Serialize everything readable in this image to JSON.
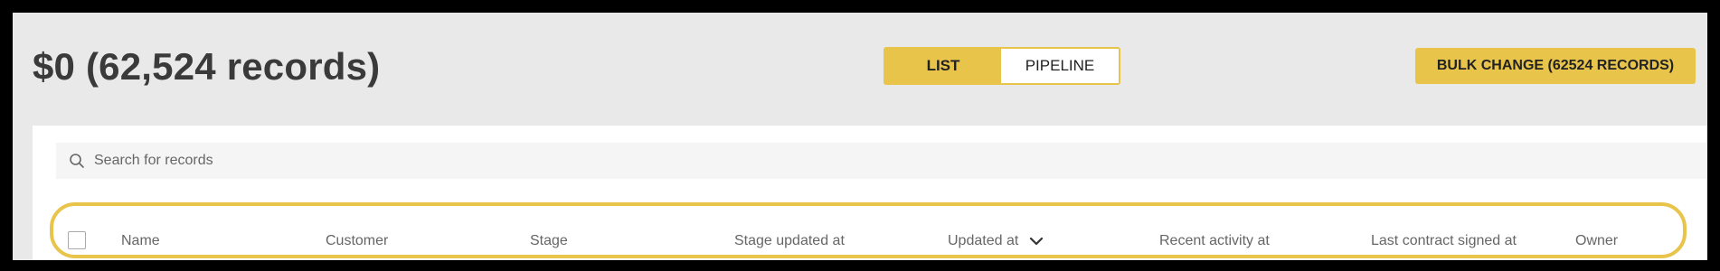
{
  "header": {
    "title": "$0 (62,524 records)"
  },
  "view_toggle": {
    "list_label": "LIST",
    "pipeline_label": "PIPELINE",
    "selected": "LIST"
  },
  "bulk_change": {
    "label": "BULK CHANGE (62524 RECORDS)"
  },
  "search": {
    "placeholder": "Search for records",
    "value": ""
  },
  "table": {
    "columns": [
      "Name",
      "Customer",
      "Stage",
      "Stage updated at",
      "Updated at",
      "Recent activity at",
      "Last contract signed at",
      "Owner"
    ],
    "sorted_column": "Updated at",
    "sort_direction": "descending"
  },
  "colors": {
    "accent": "#e8c44a",
    "background": "#e9e9e9",
    "text": "#3a3a3a"
  },
  "icons": {
    "search": "search-icon",
    "sort": "chevron-down-icon"
  }
}
